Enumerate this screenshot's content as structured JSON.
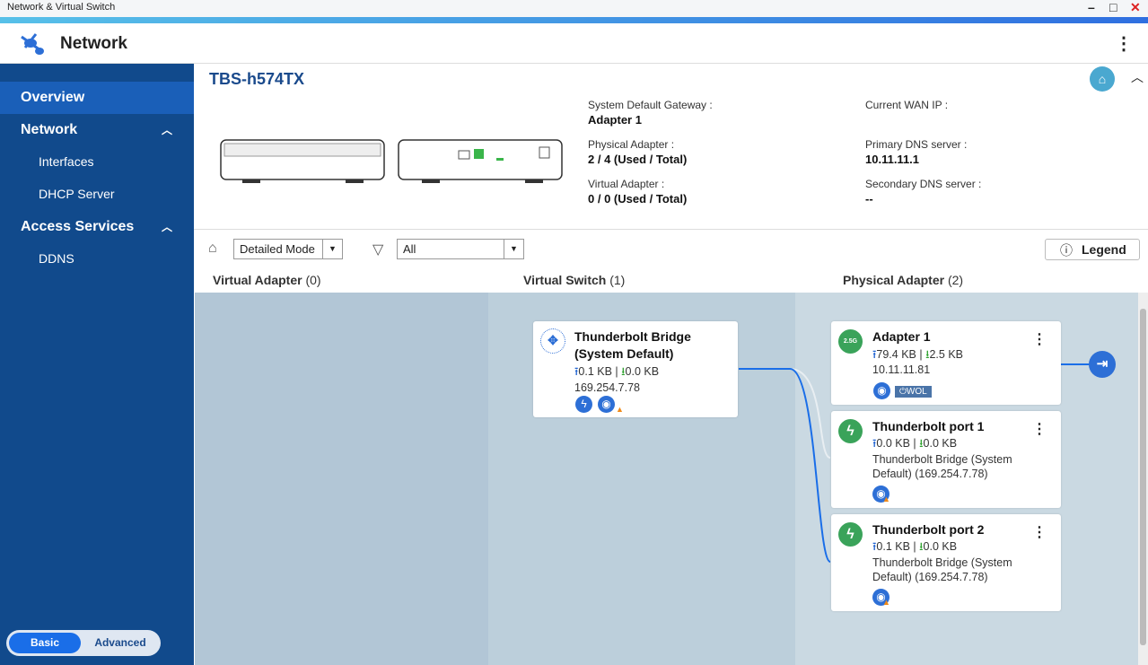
{
  "window": {
    "title": "Network & Virtual Switch"
  },
  "header": {
    "title": "Network"
  },
  "sidebar": {
    "items": [
      {
        "label": "Overview"
      },
      {
        "label": "Network"
      },
      {
        "label": "Interfaces"
      },
      {
        "label": "DHCP Server"
      },
      {
        "label": "Access Services"
      },
      {
        "label": "DDNS"
      }
    ],
    "mode": {
      "basic": "Basic",
      "advanced": "Advanced"
    }
  },
  "device": {
    "name": "TBS-h574TX",
    "gateway_label": "System Default Gateway :",
    "gateway": "Adapter 1",
    "physical_label": "Physical Adapter :",
    "physical": "2 / 4 (Used / Total)",
    "virtual_label": "Virtual Adapter :",
    "virtual": "0 / 0 (Used / Total)",
    "wan_label": "Current WAN IP :",
    "wan": "",
    "dns1_label": "Primary DNS server :",
    "dns1": "10.11.11.1",
    "dns2_label": "Secondary DNS server :",
    "dns2": "--"
  },
  "toolbar": {
    "mode_value": "Detailed Mode",
    "filter_value": "All",
    "legend": "Legend"
  },
  "columns": [
    {
      "label": "Virtual Adapter",
      "count": "(0)"
    },
    {
      "label": "Virtual Switch",
      "count": "(1)"
    },
    {
      "label": "Physical Adapter",
      "count": "(2)"
    }
  ],
  "switch": {
    "name1": "Thunderbolt Bridge",
    "name2": "(System Default)",
    "up": "0.1 KB",
    "down": "0.0 KB",
    "ip": "169.254.7.78"
  },
  "adapters": [
    {
      "name": "Adapter 1",
      "badge": "2.5G",
      "up": "79.4 KB",
      "down": "2.5 KB",
      "line1": "10.11.11.81",
      "line2": "",
      "wol": "WOL"
    },
    {
      "name": "Thunderbolt port 1",
      "up": "0.0 KB",
      "down": "0.0 KB",
      "line1": "Thunderbolt Bridge (System",
      "line2": "Default) (169.254.7.78)"
    },
    {
      "name": "Thunderbolt port 2",
      "up": "0.1 KB",
      "down": "0.0 KB",
      "line1": "Thunderbolt Bridge (System",
      "line2": "Default) (169.254.7.78)"
    }
  ],
  "colors": {
    "sidebar": "#114a8c",
    "selected": "#1a5fb8",
    "accent": "#2d6fd6",
    "green": "#3aa35a"
  }
}
